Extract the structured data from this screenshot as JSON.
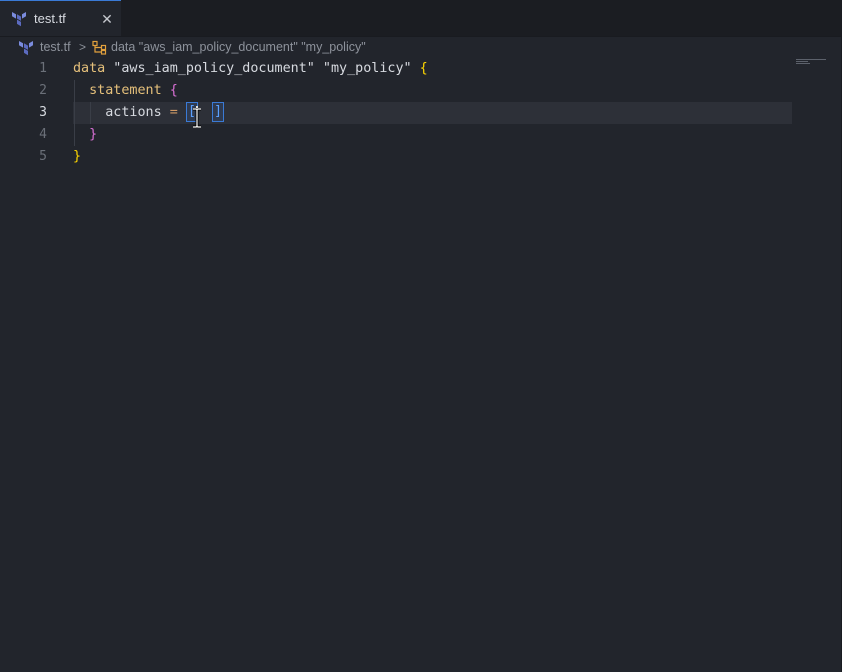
{
  "tab": {
    "file_label": "test.tf",
    "close_glyph": "✕",
    "icon": "terraform-icon"
  },
  "breadcrumb": {
    "file": "test.tf",
    "separator": ">",
    "symbol_icon": "symbol-structure-icon",
    "symbol": "data \"aws_iam_policy_document\" \"my_policy\""
  },
  "editor": {
    "active_line": 3,
    "line_numbers": [
      "1",
      "2",
      "3",
      "4",
      "5"
    ],
    "lines": [
      {
        "kw": "data",
        "rest": " \"aws_iam_policy_document\" \"my_policy\" ",
        "open": "{"
      },
      {
        "indent": "  ",
        "kw": "statement",
        "rest": " ",
        "open": "{"
      },
      {
        "indent": "    ",
        "key": "actions",
        "eq": " = ",
        "open_bracket": "[",
        "close_bracket": "]"
      },
      {
        "indent": "  ",
        "close": "}"
      },
      {
        "close": "}"
      }
    ]
  },
  "colors": {
    "accent": "#3a7ad6",
    "background": "#22252c",
    "keyword": "#e5c07b",
    "brace_level1": "#ffd700",
    "brace_level2": "#da70d6"
  }
}
